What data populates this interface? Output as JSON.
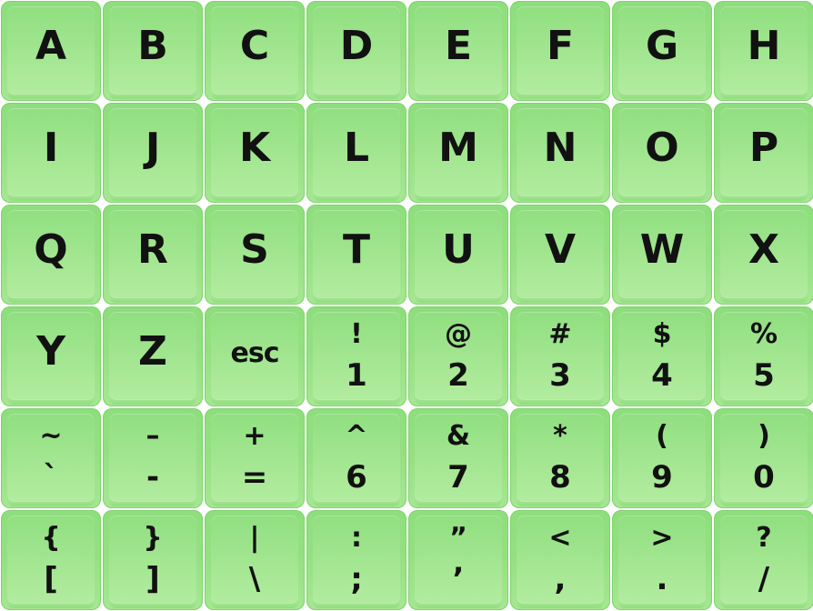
{
  "keyboard": {
    "accent": "#94e081",
    "text_color": "#111111",
    "rows": [
      [
        {
          "main": "A"
        },
        {
          "main": "B"
        },
        {
          "main": "C"
        },
        {
          "main": "D"
        },
        {
          "main": "E"
        },
        {
          "main": "F"
        },
        {
          "main": "G"
        },
        {
          "main": "H"
        }
      ],
      [
        {
          "main": "I"
        },
        {
          "main": "J"
        },
        {
          "main": "K"
        },
        {
          "main": "L"
        },
        {
          "main": "M"
        },
        {
          "main": "N"
        },
        {
          "main": "O"
        },
        {
          "main": "P"
        }
      ],
      [
        {
          "main": "Q"
        },
        {
          "main": "R"
        },
        {
          "main": "S"
        },
        {
          "main": "T"
        },
        {
          "main": "U"
        },
        {
          "main": "V"
        },
        {
          "main": "W"
        },
        {
          "main": "X"
        }
      ],
      [
        {
          "main": "Y"
        },
        {
          "main": "Z"
        },
        {
          "main": "esc"
        },
        {
          "top": "!",
          "bottom": "1"
        },
        {
          "top": "@",
          "bottom": "2"
        },
        {
          "top": "#",
          "bottom": "3"
        },
        {
          "top": "$",
          "bottom": "4"
        },
        {
          "top": "%",
          "bottom": "5"
        }
      ],
      [
        {
          "top": "~",
          "bottom": "`"
        },
        {
          "top": "–",
          "bottom": "-"
        },
        {
          "top": "+",
          "bottom": "="
        },
        {
          "top": "^",
          "bottom": "6"
        },
        {
          "top": "&",
          "bottom": "7"
        },
        {
          "top": "*",
          "bottom": "8"
        },
        {
          "top": "(",
          "bottom": "9"
        },
        {
          "top": ")",
          "bottom": "0"
        }
      ],
      [
        {
          "top": "{",
          "bottom": "["
        },
        {
          "top": "}",
          "bottom": "]"
        },
        {
          "top": "|",
          "bottom": "\\"
        },
        {
          "top": ":",
          "bottom": ";"
        },
        {
          "top": "”",
          "bottom": "’"
        },
        {
          "top": "<",
          "bottom": ","
        },
        {
          "top": ">",
          "bottom": "."
        },
        {
          "top": "?",
          "bottom": "/"
        }
      ]
    ]
  }
}
